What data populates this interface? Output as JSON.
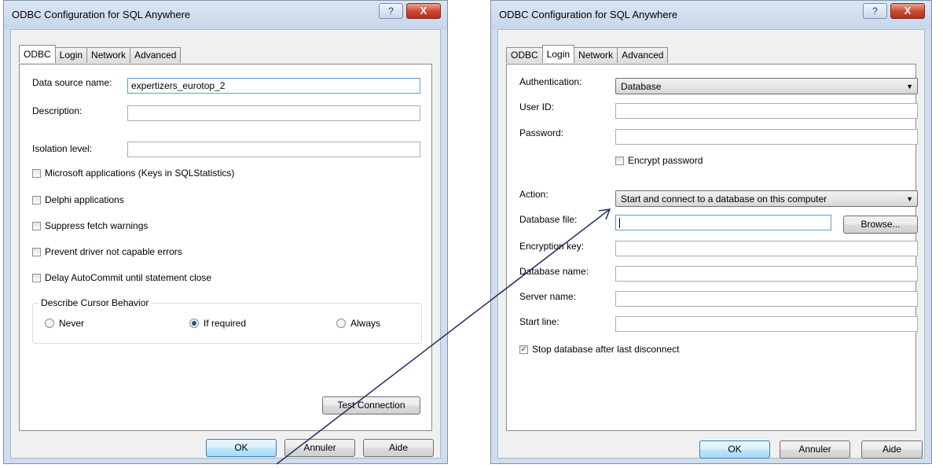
{
  "left_dialog": {
    "title": "ODBC Configuration for SQL Anywhere",
    "help_glyph": "?",
    "close_glyph": "X",
    "tabs": [
      "ODBC",
      "Login",
      "Network",
      "Advanced"
    ],
    "active_tab": "ODBC",
    "fields": {
      "data_source_name_label": "Data source name:",
      "data_source_name_value": "expertizers_eurotop_2",
      "description_label": "Description:",
      "description_value": "",
      "isolation_level_label": "Isolation level:",
      "isolation_level_value": ""
    },
    "checkboxes": [
      {
        "label": "Microsoft applications (Keys in SQLStatistics)",
        "checked": false
      },
      {
        "label": "Delphi applications",
        "checked": false
      },
      {
        "label": "Suppress fetch warnings",
        "checked": false
      },
      {
        "label": "Prevent driver not capable errors",
        "checked": false
      },
      {
        "label": "Delay AutoCommit until statement close",
        "checked": false
      }
    ],
    "cursor_group": {
      "legend": "Describe Cursor Behavior",
      "options": [
        {
          "label": "Never",
          "selected": false
        },
        {
          "label": "If required",
          "selected": true
        },
        {
          "label": "Always",
          "selected": false
        }
      ]
    },
    "test_connection_label": "Test Connection",
    "buttons": {
      "ok": "OK",
      "cancel": "Annuler",
      "help": "Aide"
    }
  },
  "right_dialog": {
    "title": "ODBC Configuration for SQL Anywhere",
    "help_glyph": "?",
    "close_glyph": "X",
    "tabs": [
      "ODBC",
      "Login",
      "Network",
      "Advanced"
    ],
    "active_tab": "Login",
    "authentication_label": "Authentication:",
    "authentication_value": "Database",
    "user_id_label": "User ID:",
    "user_id_value": "",
    "password_label": "Password:",
    "password_value": "",
    "encrypt_password_label": "Encrypt password",
    "encrypt_password_checked": false,
    "action_label": "Action:",
    "action_value": "Start and connect to a database on this computer",
    "database_file_label": "Database file:",
    "database_file_value": "",
    "browse_label": "Browse...",
    "encryption_key_label": "Encryption key:",
    "database_name_label": "Database name:",
    "server_name_label": "Server name:",
    "start_line_label": "Start line:",
    "stop_db_label": "Stop database after last disconnect",
    "stop_db_checked": true,
    "buttons": {
      "ok": "OK",
      "cancel": "Annuler",
      "help": "Aide"
    }
  },
  "annotation": {
    "arrow_color": "#1f2f5c"
  }
}
